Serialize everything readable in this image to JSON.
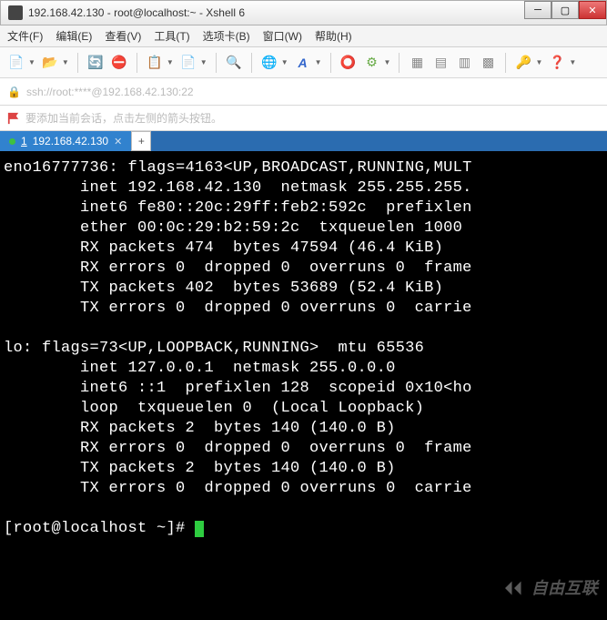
{
  "titlebar": {
    "text": "192.168.42.130 - root@localhost:~ - Xshell 6"
  },
  "menu": {
    "file": "文件(F)",
    "edit": "编辑(E)",
    "view": "查看(V)",
    "tools": "工具(T)",
    "tabs": "选项卡(B)",
    "window": "窗口(W)",
    "help": "帮助(H)"
  },
  "addressbar": {
    "text": "ssh://root:****@192.168.42.130:22"
  },
  "hintbar": {
    "text": "要添加当前会话，点击左侧的箭头按钮。"
  },
  "tab": {
    "index": "1",
    "label": "192.168.42.130"
  },
  "term": {
    "l1": "eno16777736: flags=4163<UP,BROADCAST,RUNNING,MULT",
    "l2": "        inet 192.168.42.130  netmask 255.255.255.",
    "l3": "        inet6 fe80::20c:29ff:feb2:592c  prefixlen",
    "l4": "        ether 00:0c:29:b2:59:2c  txqueuelen 1000 ",
    "l5": "        RX packets 474  bytes 47594 (46.4 KiB)",
    "l6": "        RX errors 0  dropped 0  overruns 0  frame",
    "l7": "        TX packets 402  bytes 53689 (52.4 KiB)",
    "l8": "        TX errors 0  dropped 0 overruns 0  carrie",
    "l9": "",
    "l10": "lo: flags=73<UP,LOOPBACK,RUNNING>  mtu 65536",
    "l11": "        inet 127.0.0.1  netmask 255.0.0.0",
    "l12": "        inet6 ::1  prefixlen 128  scopeid 0x10<ho",
    "l13": "        loop  txqueuelen 0  (Local Loopback)",
    "l14": "        RX packets 2  bytes 140 (140.0 B)",
    "l15": "        RX errors 0  dropped 0  overruns 0  frame",
    "l16": "        TX packets 2  bytes 140 (140.0 B)",
    "l17": "        TX errors 0  dropped 0 overruns 0  carrie",
    "l18": "",
    "prompt": "[root@localhost ~]# "
  },
  "watermark": {
    "text": "自由互联"
  }
}
